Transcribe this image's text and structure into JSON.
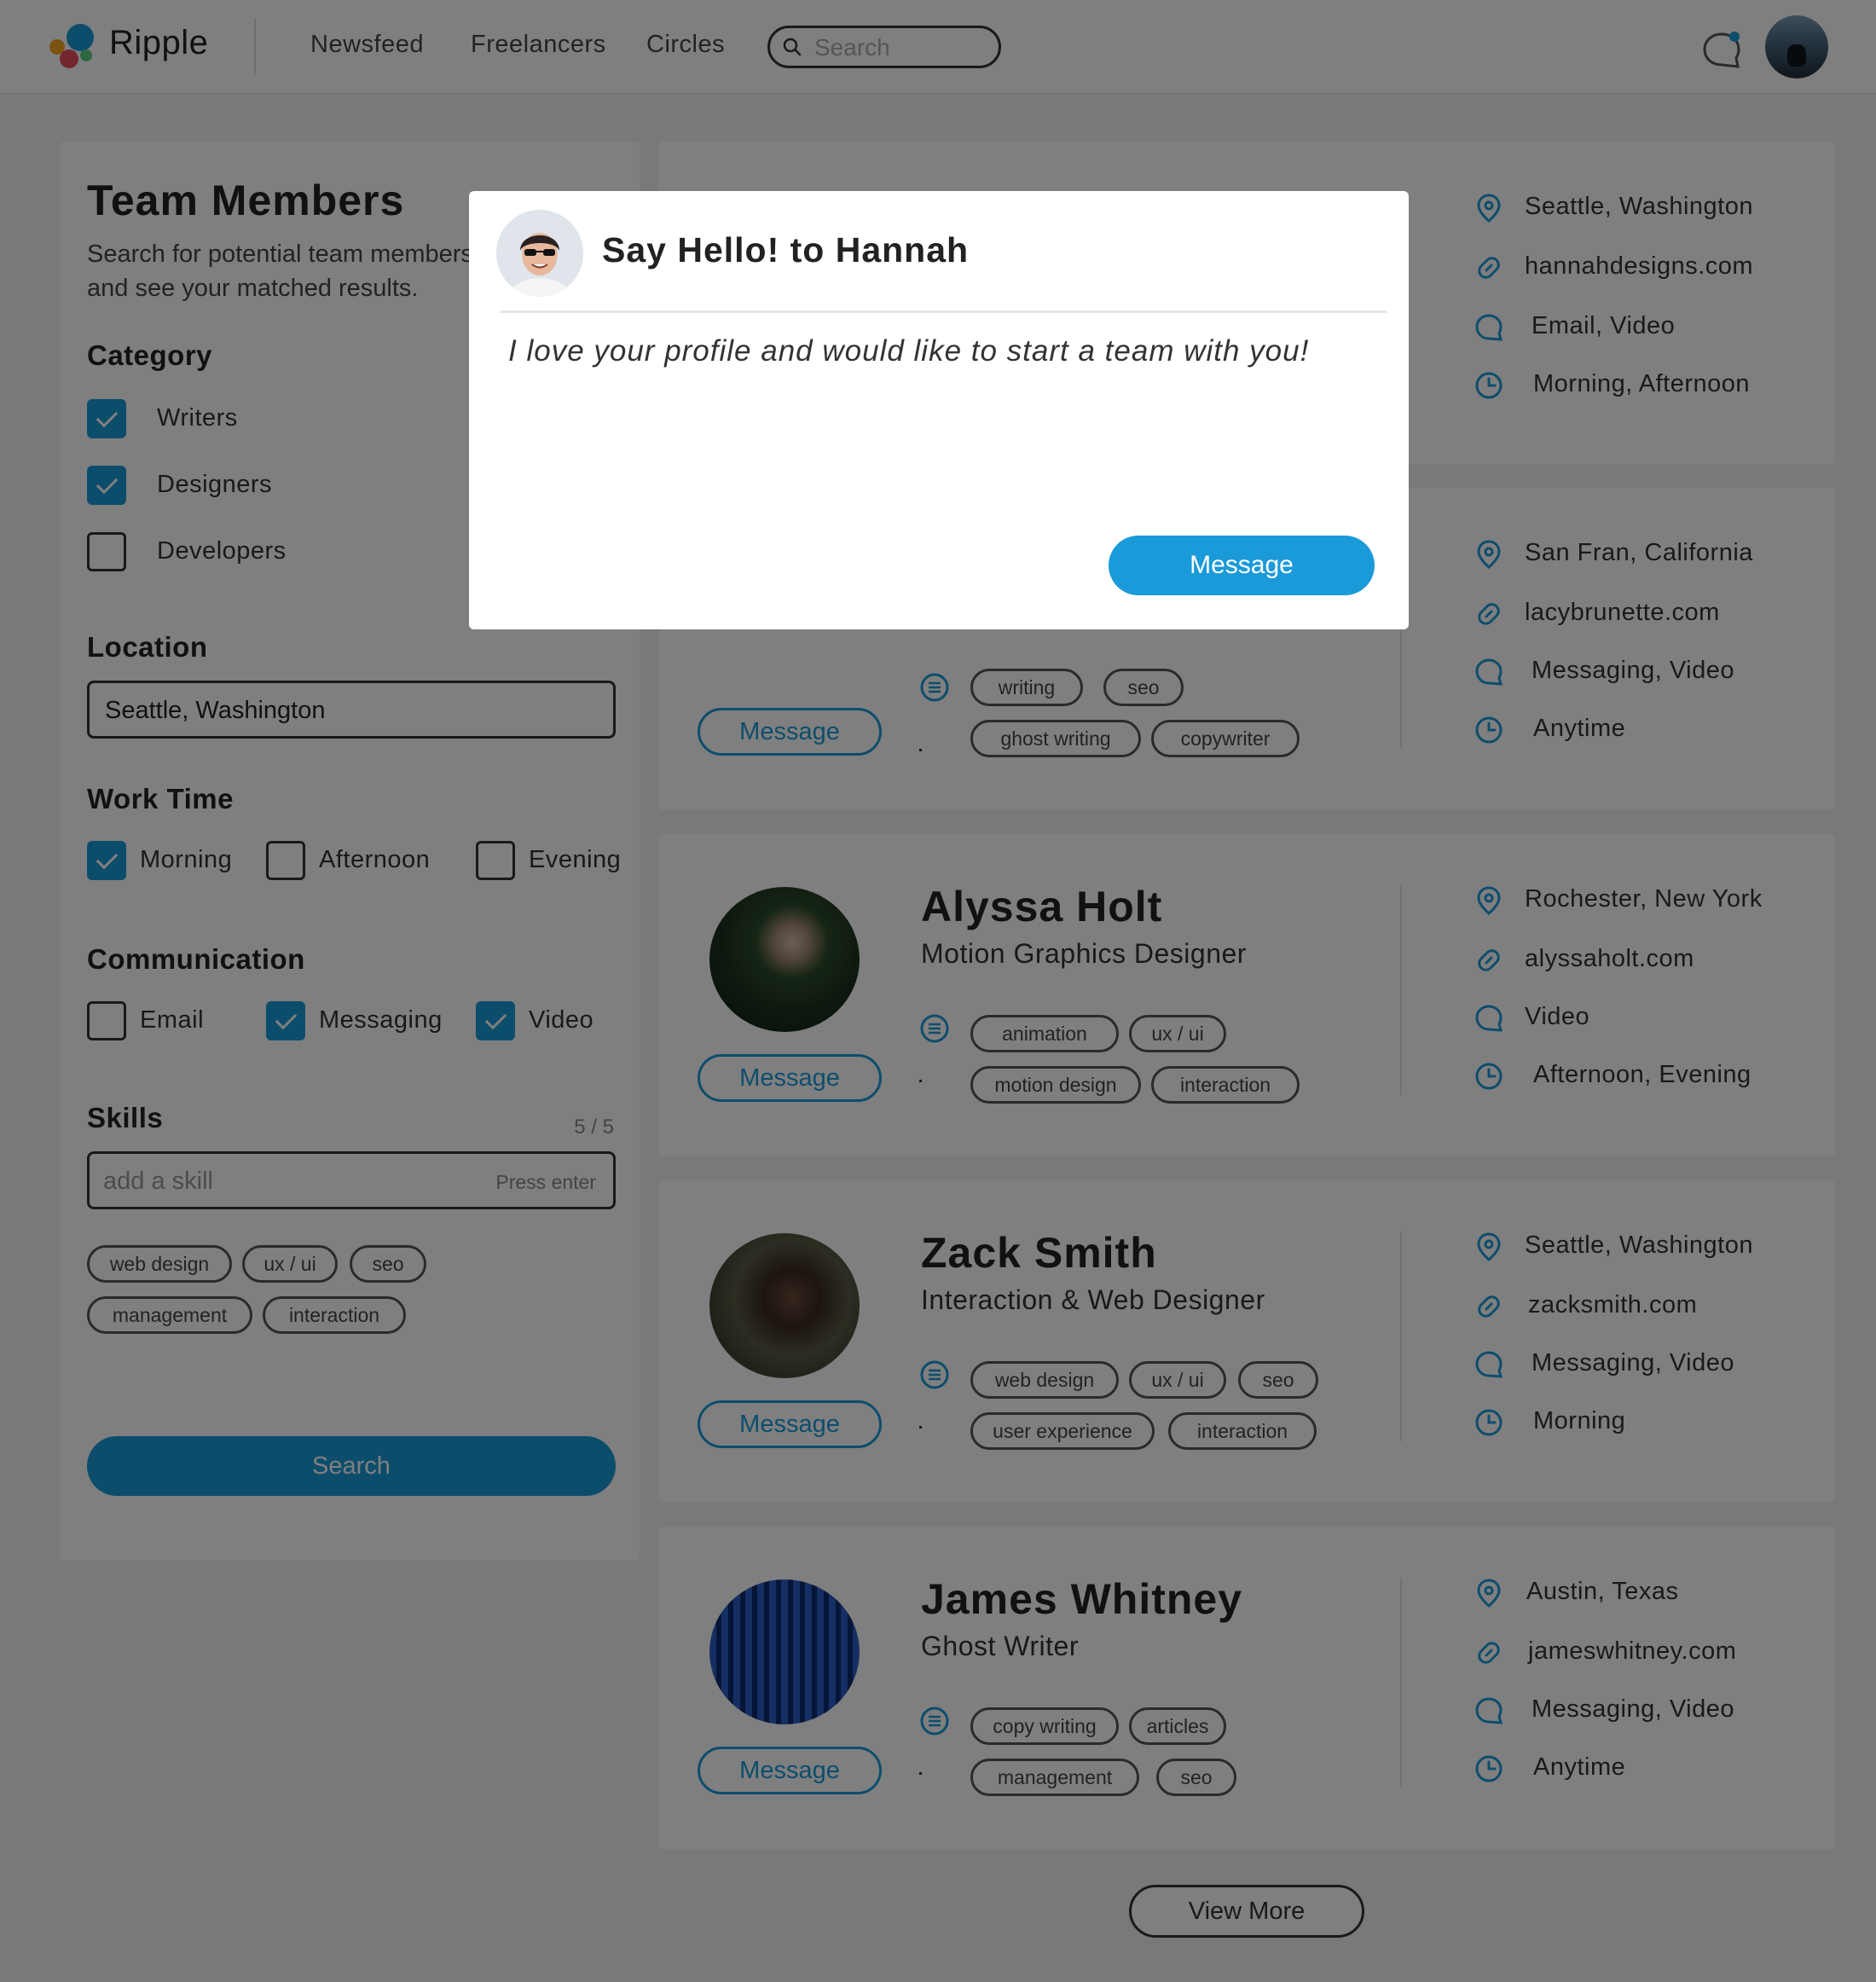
{
  "app": {
    "name": "Ripple"
  },
  "nav": {
    "items": [
      "Newsfeed",
      "Freelancers",
      "Circles"
    ],
    "search_placeholder": "Search"
  },
  "sidebar": {
    "title": "Team Members",
    "description_line1": "Search for potential team members",
    "description_line2": "and see your matched results.",
    "category": {
      "heading": "Category",
      "options": [
        {
          "label": "Writers",
          "checked": true
        },
        {
          "label": "Designers",
          "checked": true
        },
        {
          "label": "Developers",
          "checked": false
        }
      ]
    },
    "location": {
      "heading": "Location",
      "value": "Seattle, Washington"
    },
    "work_time": {
      "heading": "Work Time",
      "options": [
        {
          "label": "Morning",
          "checked": true
        },
        {
          "label": "Afternoon",
          "checked": false
        },
        {
          "label": "Evening",
          "checked": false
        }
      ]
    },
    "communication": {
      "heading": "Communication",
      "options": [
        {
          "label": "Email",
          "checked": false
        },
        {
          "label": "Messaging",
          "checked": true
        },
        {
          "label": "Video",
          "checked": true
        }
      ]
    },
    "skills": {
      "heading": "Skills",
      "count": "5 / 5",
      "placeholder": "add a skill",
      "hint": "Press enter",
      "chips": [
        "web design",
        "ux / ui",
        "seo",
        "management",
        "interaction"
      ]
    },
    "search_button": "Search"
  },
  "cards": [
    {
      "name": "",
      "role": "",
      "tags": [],
      "message_label": "",
      "location": "Seattle, Washington",
      "website": "hannahdesigns.com",
      "communication": "Email, Video",
      "availability": "Morning, Afternoon"
    },
    {
      "name": "",
      "role": "",
      "tags": [
        "writing",
        "seo",
        "ghost writing",
        "copywriter"
      ],
      "message_label": "Message",
      "location": "San Fran, California",
      "website": "lacybrunette.com",
      "communication": "Messaging, Video",
      "availability": "Anytime"
    },
    {
      "name": "Alyssa Holt",
      "role": "Motion Graphics Designer",
      "tags": [
        "animation",
        "ux / ui",
        "motion design",
        "interaction"
      ],
      "message_label": "Message",
      "location": "Rochester, New York",
      "website": "alyssaholt.com",
      "communication": "Video",
      "availability": "Afternoon, Evening"
    },
    {
      "name": "Zack Smith",
      "role": "Interaction & Web Designer",
      "tags": [
        "web design",
        "ux / ui",
        "seo",
        "user experience",
        "interaction"
      ],
      "message_label": "Message",
      "location": "Seattle, Washington",
      "website": "zacksmith.com",
      "communication": "Messaging, Video",
      "availability": "Morning"
    },
    {
      "name": "James Whitney",
      "role": "Ghost Writer",
      "tags": [
        "copy writing",
        "articles",
        "management",
        "seo"
      ],
      "message_label": "Message",
      "location": "Austin, Texas",
      "website": "jameswhitney.com",
      "communication": "Messaging, Video",
      "availability": "Anytime"
    }
  ],
  "view_more": "View More",
  "modal": {
    "title": "Say Hello! to Hannah",
    "message": "I love your profile and would like to start a team with you!",
    "send_button": "Message"
  },
  "colors": {
    "accent": "#1a9ad9",
    "overlay": "rgba(0,0,0,0.5)"
  }
}
